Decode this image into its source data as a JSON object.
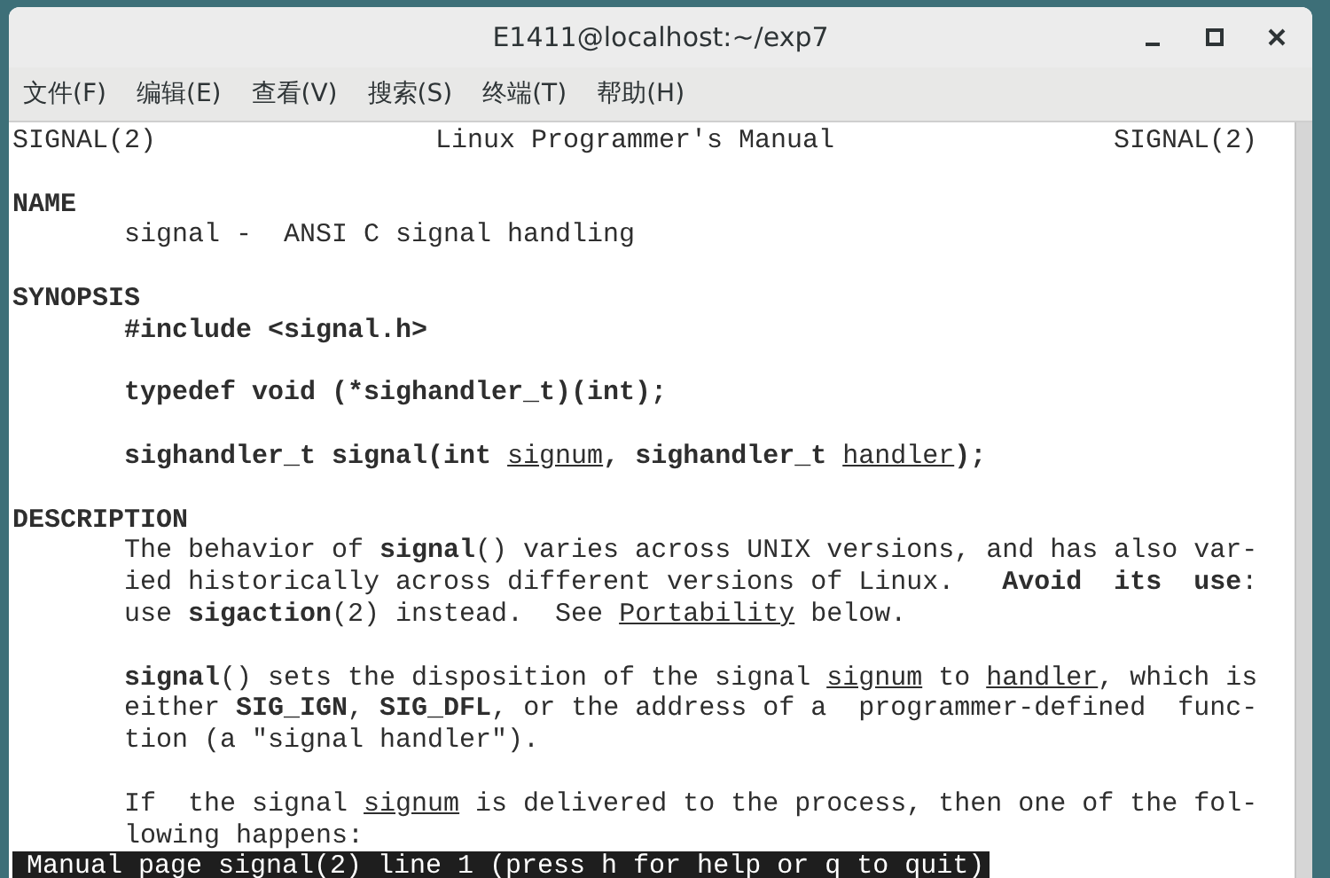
{
  "window": {
    "title": "E1411@localhost:~/exp7"
  },
  "menu": [
    {
      "label": "文件(F)"
    },
    {
      "label": "编辑(E)"
    },
    {
      "label": "查看(V)"
    },
    {
      "label": "搜索(S)"
    },
    {
      "label": "终端(T)"
    },
    {
      "label": "帮助(H)"
    }
  ],
  "terminal": {
    "lines": [
      {
        "kind": "header",
        "left": "SIGNAL(2)",
        "center": "Linux Programmer's Manual",
        "right": "SIGNAL(2)"
      },
      {
        "kind": "blank"
      },
      {
        "kind": "heading",
        "text": "NAME"
      },
      {
        "kind": "body",
        "segments": [
          {
            "text": "signal -  ANSI C signal handling",
            "kind": "plain"
          }
        ]
      },
      {
        "kind": "blank"
      },
      {
        "kind": "heading",
        "text": "SYNOPSIS"
      },
      {
        "kind": "body",
        "segments": [
          {
            "text": "#include <signal.h>",
            "kind": "bold"
          }
        ]
      },
      {
        "kind": "blank"
      },
      {
        "kind": "body",
        "segments": [
          {
            "text": "typedef void (*sighandler_t)(int);",
            "kind": "bold"
          }
        ]
      },
      {
        "kind": "blank"
      },
      {
        "kind": "body",
        "segments": [
          {
            "text": "sighandler_t signal(int ",
            "kind": "bold"
          },
          {
            "text": "signum",
            "kind": "underline"
          },
          {
            "text": ", sighandler_t ",
            "kind": "bold"
          },
          {
            "text": "handler",
            "kind": "underline"
          },
          {
            "text": ");",
            "kind": "bold"
          }
        ]
      },
      {
        "kind": "blank"
      },
      {
        "kind": "heading",
        "text": "DESCRIPTION"
      },
      {
        "kind": "body",
        "segments": [
          {
            "text": "The behavior of ",
            "kind": "plain"
          },
          {
            "text": "signal",
            "kind": "bold"
          },
          {
            "text": "() varies across UNIX versions, and has also var-",
            "kind": "plain"
          }
        ]
      },
      {
        "kind": "body",
        "segments": [
          {
            "text": "ied historically across different versions of Linux.   ",
            "kind": "plain"
          },
          {
            "text": "Avoid  its  use",
            "kind": "bold"
          },
          {
            "text": ":",
            "kind": "plain"
          }
        ]
      },
      {
        "kind": "body",
        "segments": [
          {
            "text": "use ",
            "kind": "plain"
          },
          {
            "text": "sigaction",
            "kind": "bold"
          },
          {
            "text": "(2) instead.  See ",
            "kind": "plain"
          },
          {
            "text": "Portability",
            "kind": "underline"
          },
          {
            "text": " below.",
            "kind": "plain"
          }
        ]
      },
      {
        "kind": "blank"
      },
      {
        "kind": "body",
        "segments": [
          {
            "text": "signal",
            "kind": "bold"
          },
          {
            "text": "() sets the disposition of the signal ",
            "kind": "plain"
          },
          {
            "text": "signum",
            "kind": "underline"
          },
          {
            "text": " to ",
            "kind": "plain"
          },
          {
            "text": "handler",
            "kind": "underline"
          },
          {
            "text": ", which is",
            "kind": "plain"
          }
        ]
      },
      {
        "kind": "body",
        "segments": [
          {
            "text": "either ",
            "kind": "plain"
          },
          {
            "text": "SIG_IGN",
            "kind": "bold"
          },
          {
            "text": ", ",
            "kind": "plain"
          },
          {
            "text": "SIG_DFL",
            "kind": "bold"
          },
          {
            "text": ", or the address of a  programmer-defined  func-",
            "kind": "plain"
          }
        ]
      },
      {
        "kind": "body",
        "segments": [
          {
            "text": "tion (a \"signal handler\").",
            "kind": "plain"
          }
        ]
      },
      {
        "kind": "blank"
      },
      {
        "kind": "body",
        "segments": [
          {
            "text": "If  the signal ",
            "kind": "plain"
          },
          {
            "text": "signum",
            "kind": "underline"
          },
          {
            "text": " is delivered to the process, then one of the fol-",
            "kind": "plain"
          }
        ]
      },
      {
        "kind": "body",
        "segments": [
          {
            "text": "lowing happens:",
            "kind": "plain"
          }
        ]
      }
    ],
    "status_line": "Manual page signal(2) line 1 (press h for help or q to quit)"
  }
}
